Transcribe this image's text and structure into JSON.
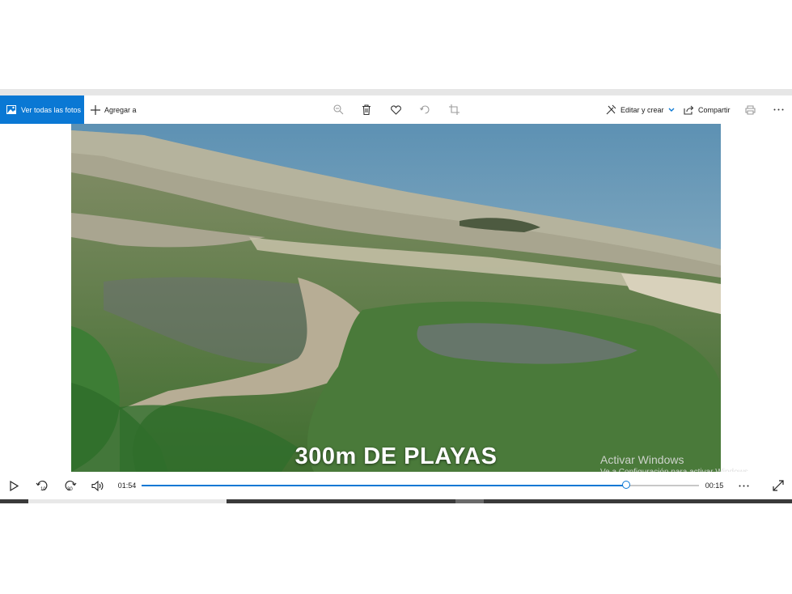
{
  "toolbar": {
    "view_all_label": "Ver todas las fotos",
    "add_to_label": "Agregar a",
    "edit_create_label": "Editar y crear",
    "share_label": "Compartir",
    "icons": [
      "image-icon",
      "plus-icon",
      "zoom-icon",
      "delete-icon",
      "heart-icon",
      "rotate-icon",
      "crop-icon",
      "edit-icon",
      "chevron-down-icon",
      "share-icon",
      "print-icon",
      "more-icon"
    ]
  },
  "video": {
    "caption": "300m DE PLAYAS"
  },
  "watermark": {
    "title": "Activar Windows",
    "subtitle": "Ve a Configuración para activar Windows."
  },
  "player": {
    "elapsed": "01:54",
    "remaining": "00:15",
    "skip_back_label": "10",
    "skip_forward_label": "30",
    "progress": 0.87
  },
  "colors": {
    "accent": "#0a78d4"
  }
}
